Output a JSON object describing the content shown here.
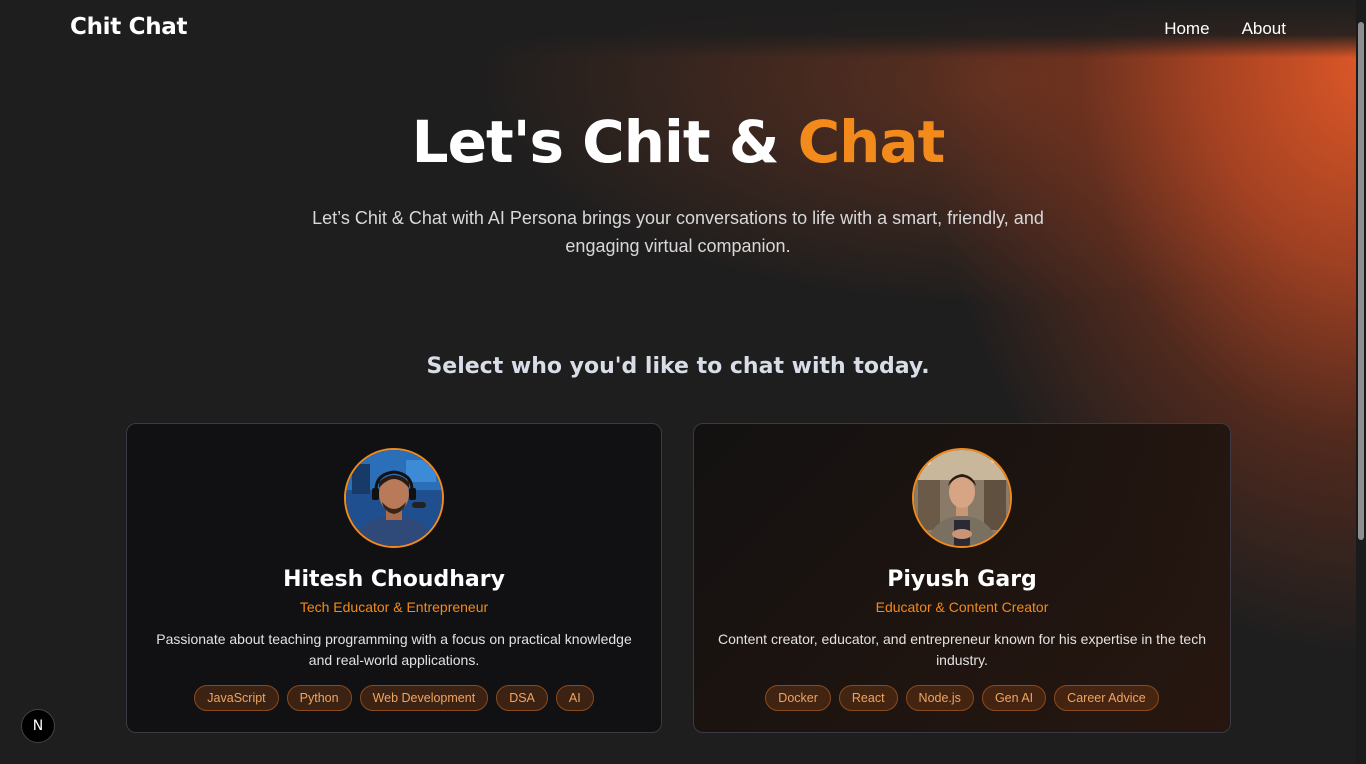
{
  "brand": {
    "name": "Chit Chat"
  },
  "nav": {
    "items": [
      {
        "label": "Home"
      },
      {
        "label": "About"
      }
    ]
  },
  "hero": {
    "title_main": "Let's Chit & ",
    "title_accent": "Chat",
    "subtitle": "Let’s Chit & Chat with AI Persona brings your conversations to life with a smart, friendly, and engaging virtual companion."
  },
  "select_heading": "Select who you'd like to chat with today.",
  "personas": [
    {
      "name": "Hitesh Choudhary",
      "role": "Tech Educator & Entrepreneur",
      "description": "Passionate about teaching programming with a focus on practical knowledge and real-world applications.",
      "tags": [
        "JavaScript",
        "Python",
        "Web Development",
        "DSA",
        "AI"
      ]
    },
    {
      "name": "Piyush Garg",
      "role": "Educator & Content Creator",
      "description": "Content creator, educator, and entrepreneur known for his expertise in the tech industry.",
      "tags": [
        "Docker",
        "React",
        "Node.js",
        "Gen AI",
        "Career Advice"
      ]
    }
  ],
  "dev_badge": {
    "label": "N"
  },
  "colors": {
    "accent": "#f28a1c",
    "background": "#1e1e1e",
    "glow": "#d9552a"
  }
}
